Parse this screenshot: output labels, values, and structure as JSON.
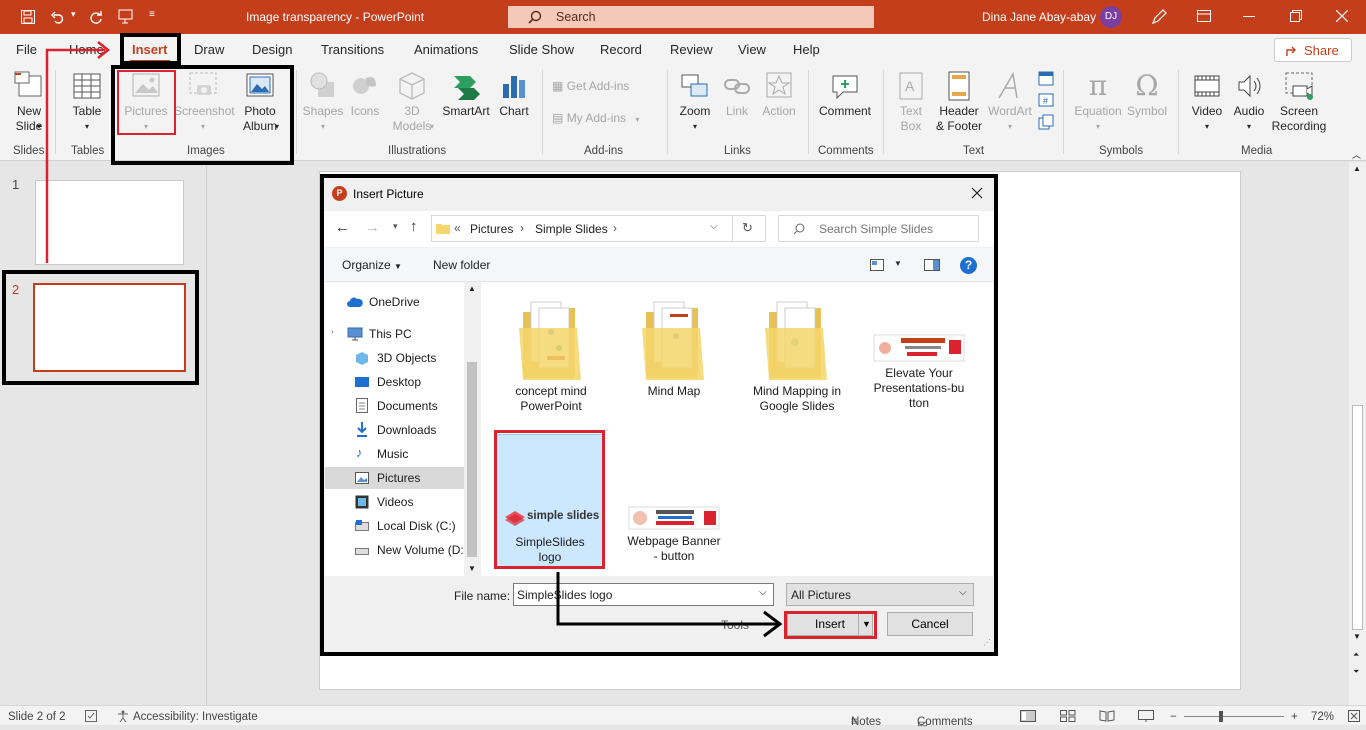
{
  "window": {
    "doc_title": "Image transparency",
    "app_name": "PowerPoint",
    "title_sep": "-",
    "search_placeholder": "Search",
    "user_name": "Dina Jane Abay-abay",
    "user_initials": "DJ"
  },
  "tabs": [
    "File",
    "Home",
    "Insert",
    "Draw",
    "Design",
    "Transitions",
    "Animations",
    "Slide Show",
    "Record",
    "Review",
    "View",
    "Help"
  ],
  "share_label": "Share",
  "ribbon": {
    "new_slide": [
      "New",
      "Slide"
    ],
    "table": "Table",
    "pictures": "Pictures",
    "screenshot": "Screenshot",
    "photo_album": [
      "Photo",
      "Album"
    ],
    "shapes": "Shapes",
    "icons": "Icons",
    "models3d": [
      "3D",
      "Models"
    ],
    "smartart": "SmartArt",
    "chart": "Chart",
    "get_addins": "Get Add-ins",
    "my_addins": "My Add-ins",
    "zoom": "Zoom",
    "link": "Link",
    "action": "Action",
    "comment": "Comment",
    "textbox": [
      "Text",
      "Box"
    ],
    "header_footer": [
      "Header",
      "& Footer"
    ],
    "wordart": "WordArt",
    "equation": "Equation",
    "symbol": "Symbol",
    "video": "Video",
    "audio": "Audio",
    "screen_recording": [
      "Screen",
      "Recording"
    ],
    "groups": [
      "Slides",
      "Tables",
      "Images",
      "Illustrations",
      "Add-ins",
      "Links",
      "Comments",
      "Text",
      "Symbols",
      "Media"
    ]
  },
  "slides": [
    {
      "num": "1"
    },
    {
      "num": "2"
    }
  ],
  "dialog": {
    "title": "Insert Picture",
    "path": [
      "Pictures",
      "Simple Slides"
    ],
    "path_prefix": "«",
    "search_placeholder": "Search Simple Slides",
    "organize": "Organize",
    "new_folder": "New folder",
    "help": "?",
    "tree": [
      "OneDrive",
      "This PC",
      "3D Objects",
      "Desktop",
      "Documents",
      "Downloads",
      "Music",
      "Pictures",
      "Videos",
      "Local Disk (C:)",
      "New Volume (D:"
    ],
    "files": [
      {
        "name": [
          "concept mind",
          "PowerPoint"
        ]
      },
      {
        "name": [
          "Mind Map"
        ]
      },
      {
        "name": [
          "Mind Mapping in",
          "Google Slides"
        ]
      },
      {
        "name": [
          "Elevate Your",
          "Presentations-bu",
          "tton"
        ]
      },
      {
        "name": [
          "SimpleSlides",
          "logo"
        ],
        "thumb_text": "simple slides"
      },
      {
        "name": [
          "Webpage Banner",
          "- button"
        ]
      }
    ],
    "file_name_label": "File name:",
    "file_name_value": "SimpleSlides logo",
    "filter_value": "All Pictures",
    "tools_label": "Tools",
    "insert_label": "Insert",
    "cancel_label": "Cancel"
  },
  "status": {
    "slide_info": "Slide 2 of 2",
    "accessibility": "Accessibility: Investigate",
    "notes": "Notes",
    "comments": "Comments",
    "zoom": "72%"
  },
  "colors": {
    "accent": "#c43e1c",
    "highlight": "#d9232f",
    "selection": "#cce8ff"
  }
}
